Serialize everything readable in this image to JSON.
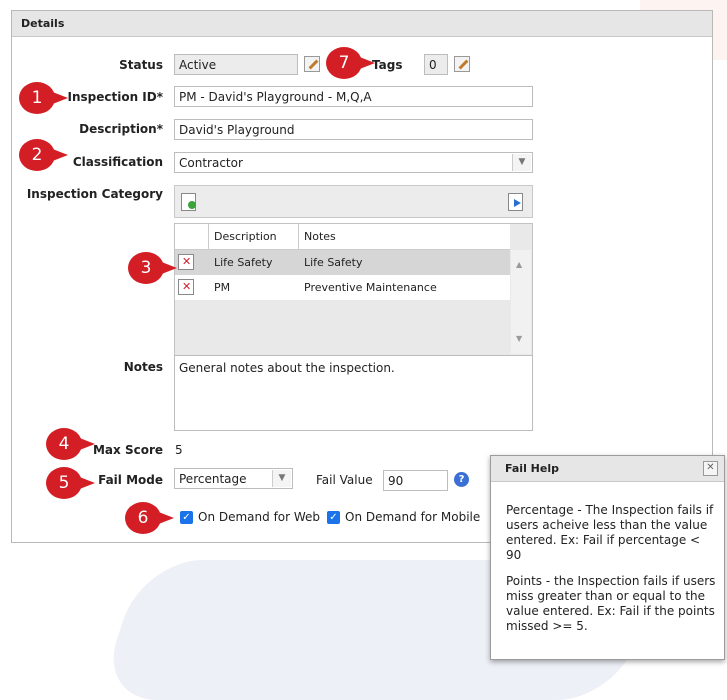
{
  "panel": {
    "title": "Details"
  },
  "status": {
    "label": "Status",
    "value": "Active"
  },
  "tags": {
    "label": "Tags",
    "value": "0"
  },
  "inspection_id": {
    "label": "Inspection ID*",
    "value": "PM - David's Playground - M,Q,A"
  },
  "description": {
    "label": "Description*",
    "value": "David's Playground"
  },
  "classification": {
    "label": "Classification",
    "value": "Contractor"
  },
  "inspection_category": {
    "label": "Inspection Category",
    "columns": [
      "Description",
      "Notes"
    ],
    "rows": [
      {
        "description": "Life Safety",
        "notes": "Life Safety"
      },
      {
        "description": "PM",
        "notes": "Preventive Maintenance"
      }
    ]
  },
  "notes": {
    "label": "Notes",
    "value": "General notes about the inspection."
  },
  "max_score": {
    "label": "Max Score",
    "value": "5"
  },
  "fail_mode": {
    "label": "Fail Mode",
    "value": "Percentage"
  },
  "fail_value": {
    "label": "Fail Value",
    "value": "90"
  },
  "on_demand_web": {
    "label": "On Demand for Web",
    "checked": true
  },
  "on_demand_mobile": {
    "label": "On Demand for Mobile",
    "checked": true
  },
  "fail_help": {
    "title": "Fail Help",
    "para1": "Percentage - The Inspection fails if users acheive less than the value entered. Ex: Fail if percentage < 90",
    "para2": "Points - the Inspection fails if users miss greater than or equal to the value entered. Ex: Fail if the points missed >= 5."
  },
  "callouts": [
    "1",
    "2",
    "3",
    "4",
    "5",
    "6",
    "7"
  ],
  "colors": {
    "callout": "#d41e25",
    "checkbox": "#1a73e8",
    "help": "#3b6fd6"
  }
}
